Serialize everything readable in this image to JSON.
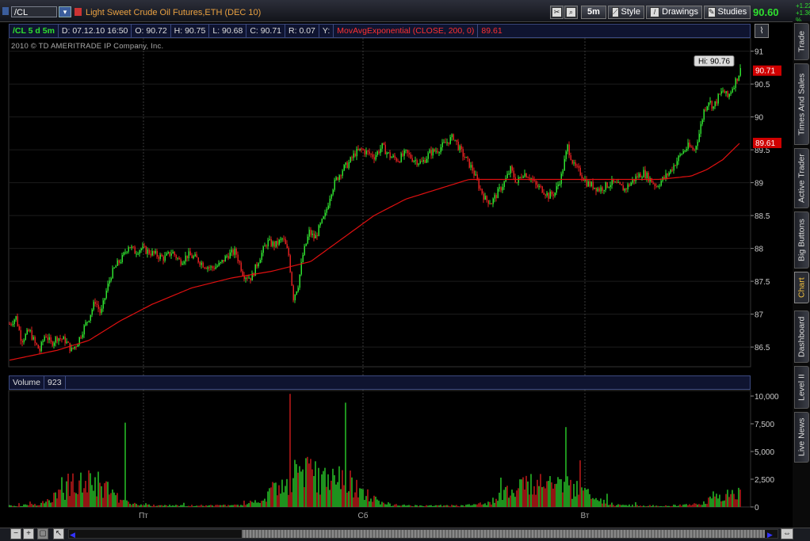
{
  "toolbar": {
    "symbol": "/CL",
    "description": "Light Sweet Crude Oil Futures,ETH (DEC 10)",
    "timeframe": "5m",
    "style_label": "Style",
    "drawings_label": "Drawings",
    "studies_label": "Studies",
    "last_price": "90.60",
    "change": "+1.22",
    "change_pct": "+1.36 %"
  },
  "info_bar": {
    "symbol_period": "/CL 5 d 5m",
    "date": "D: 07.12.10 16:50",
    "open": "O: 90.72",
    "high": "H: 90.75",
    "low": "L: 90.68",
    "close": "C: 90.71",
    "range": "R: 0.07",
    "y": "Y:",
    "study": "MovAvgExponential (CLOSE, 200, 0)",
    "study_value": "89.61"
  },
  "copyright": "2010 © TD AMERITRADE IP Company, Inc.",
  "volume_bar": {
    "label": "Volume",
    "value": "923"
  },
  "right_tabs": [
    {
      "label": "Trade"
    },
    {
      "label": "Times And Sales"
    },
    {
      "label": "Active Trader"
    },
    {
      "label": "Big Buttons"
    },
    {
      "label": "Chart"
    },
    {
      "label": "Dashboard"
    },
    {
      "label": "Level II"
    },
    {
      "label": "Live News"
    }
  ],
  "colors": {
    "up": "#2fe02f",
    "down": "#e02020",
    "ema": "#e01010",
    "grid": "#3a3a3a",
    "panel_header": "#0f1430"
  },
  "chart_data": {
    "type": "candlestick",
    "price_axis": {
      "ticks": [
        "91",
        "90.5",
        "90",
        "89.5",
        "89",
        "88.5",
        "88",
        "87.5",
        "87",
        "86.5"
      ],
      "range": [
        86.2,
        91.2
      ]
    },
    "x_ticks": [
      "Пт",
      "Сб",
      "Вт"
    ],
    "hi_label": "Hi: 90.76",
    "last_marker": "90.71",
    "ema_marker": "89.61",
    "volume_axis": {
      "ticks": [
        "10,000",
        "7,500",
        "5,000",
        "2,500",
        "0"
      ],
      "range": [
        0,
        10500
      ]
    },
    "close_path": [
      [
        0,
        86.85
      ],
      [
        8,
        86.95
      ],
      [
        15,
        86.6
      ],
      [
        25,
        86.75
      ],
      [
        32,
        86.55
      ],
      [
        38,
        86.45
      ],
      [
        45,
        86.7
      ],
      [
        52,
        86.55
      ],
      [
        60,
        86.65
      ],
      [
        70,
        86.6
      ],
      [
        78,
        86.45
      ],
      [
        85,
        86.55
      ],
      [
        92,
        86.75
      ],
      [
        100,
        86.95
      ],
      [
        108,
        87.2
      ],
      [
        115,
        87.0
      ],
      [
        122,
        87.35
      ],
      [
        128,
        87.6
      ],
      [
        135,
        87.75
      ],
      [
        142,
        87.85
      ],
      [
        150,
        88.05
      ],
      [
        158,
        87.95
      ],
      [
        166,
        88.0
      ],
      [
        175,
        87.95
      ],
      [
        185,
        87.9
      ],
      [
        195,
        87.85
      ],
      [
        205,
        87.95
      ],
      [
        215,
        87.8
      ],
      [
        225,
        87.9
      ],
      [
        235,
        87.85
      ],
      [
        245,
        87.75
      ],
      [
        255,
        87.7
      ],
      [
        265,
        87.75
      ],
      [
        275,
        87.9
      ],
      [
        285,
        87.95
      ],
      [
        295,
        87.6
      ],
      [
        305,
        87.55
      ],
      [
        315,
        87.85
      ],
      [
        325,
        88.1
      ],
      [
        335,
        88.05
      ],
      [
        345,
        88.15
      ],
      [
        352,
        87.9
      ],
      [
        358,
        87.25
      ],
      [
        364,
        87.45
      ],
      [
        370,
        87.9
      ],
      [
        378,
        88.25
      ],
      [
        385,
        88.15
      ],
      [
        392,
        88.35
      ],
      [
        398,
        88.5
      ],
      [
        405,
        88.85
      ],
      [
        412,
        89.05
      ],
      [
        420,
        89.2
      ],
      [
        428,
        89.3
      ],
      [
        436,
        89.45
      ],
      [
        444,
        89.5
      ],
      [
        452,
        89.45
      ],
      [
        460,
        89.4
      ],
      [
        470,
        89.55
      ],
      [
        480,
        89.4
      ],
      [
        490,
        89.35
      ],
      [
        500,
        89.45
      ],
      [
        510,
        89.35
      ],
      [
        520,
        89.3
      ],
      [
        530,
        89.45
      ],
      [
        540,
        89.5
      ],
      [
        550,
        89.6
      ],
      [
        560,
        89.7
      ],
      [
        568,
        89.5
      ],
      [
        576,
        89.35
      ],
      [
        584,
        89.2
      ],
      [
        592,
        88.95
      ],
      [
        600,
        88.75
      ],
      [
        608,
        88.7
      ],
      [
        616,
        88.85
      ],
      [
        624,
        89.0
      ],
      [
        632,
        89.2
      ],
      [
        640,
        89.0
      ],
      [
        648,
        89.15
      ],
      [
        656,
        89.1
      ],
      [
        664,
        88.95
      ],
      [
        672,
        88.9
      ],
      [
        680,
        88.8
      ],
      [
        688,
        88.85
      ],
      [
        696,
        89.1
      ],
      [
        704,
        89.55
      ],
      [
        712,
        89.25
      ],
      [
        720,
        89.15
      ],
      [
        728,
        89.0
      ],
      [
        736,
        88.95
      ],
      [
        744,
        88.9
      ],
      [
        752,
        88.95
      ],
      [
        760,
        89.0
      ],
      [
        768,
        88.95
      ],
      [
        776,
        88.9
      ],
      [
        784,
        89.0
      ],
      [
        792,
        89.1
      ],
      [
        800,
        89.15
      ],
      [
        808,
        89.05
      ],
      [
        816,
        88.95
      ],
      [
        824,
        89.05
      ],
      [
        832,
        89.15
      ],
      [
        840,
        89.3
      ],
      [
        848,
        89.45
      ],
      [
        856,
        89.55
      ],
      [
        864,
        89.5
      ],
      [
        870,
        89.75
      ],
      [
        876,
        90.1
      ],
      [
        882,
        90.25
      ],
      [
        888,
        90.15
      ],
      [
        894,
        90.3
      ],
      [
        900,
        90.4
      ],
      [
        906,
        90.3
      ],
      [
        912,
        90.45
      ],
      [
        918,
        90.6
      ],
      [
        922,
        90.71
      ]
    ],
    "ema_path": [
      [
        0,
        86.3
      ],
      [
        60,
        86.45
      ],
      [
        100,
        86.6
      ],
      [
        140,
        86.9
      ],
      [
        180,
        87.15
      ],
      [
        230,
        87.4
      ],
      [
        280,
        87.55
      ],
      [
        330,
        87.65
      ],
      [
        380,
        87.8
      ],
      [
        420,
        88.15
      ],
      [
        460,
        88.5
      ],
      [
        500,
        88.75
      ],
      [
        540,
        88.9
      ],
      [
        580,
        89.05
      ],
      [
        620,
        89.05
      ],
      [
        660,
        89.05
      ],
      [
        700,
        89.05
      ],
      [
        740,
        89.05
      ],
      [
        780,
        89.05
      ],
      [
        820,
        89.05
      ],
      [
        860,
        89.1
      ],
      [
        880,
        89.2
      ],
      [
        900,
        89.35
      ],
      [
        922,
        89.61
      ]
    ]
  }
}
